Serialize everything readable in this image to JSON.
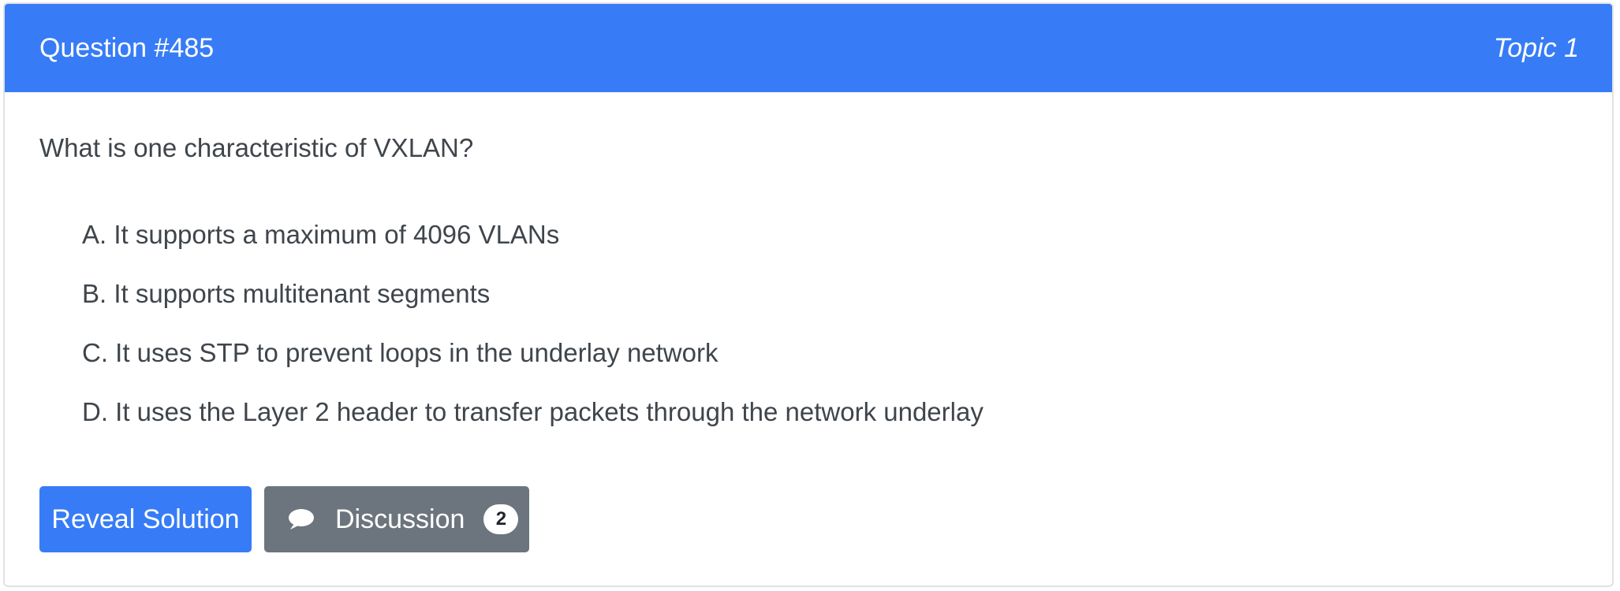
{
  "header": {
    "question_number": "Question #485",
    "topic": "Topic 1"
  },
  "question": {
    "text": "What is one characteristic of VXLAN?",
    "choices": [
      {
        "label": "A. It supports a maximum of 4096 VLANs"
      },
      {
        "label": "B. It supports multitenant segments"
      },
      {
        "label": "C. It uses STP to prevent loops in the underlay network"
      },
      {
        "label": "D. It uses the Layer 2 header to transfer packets through the network underlay"
      }
    ]
  },
  "actions": {
    "reveal_label": "Reveal Solution",
    "discussion_label": "Discussion",
    "discussion_count": "2",
    "discussion_icon": "chat-bubble-icon"
  },
  "colors": {
    "primary": "#377cf6",
    "secondary": "#6c757d",
    "text": "#3f454b",
    "border": "#dfe2e6"
  }
}
